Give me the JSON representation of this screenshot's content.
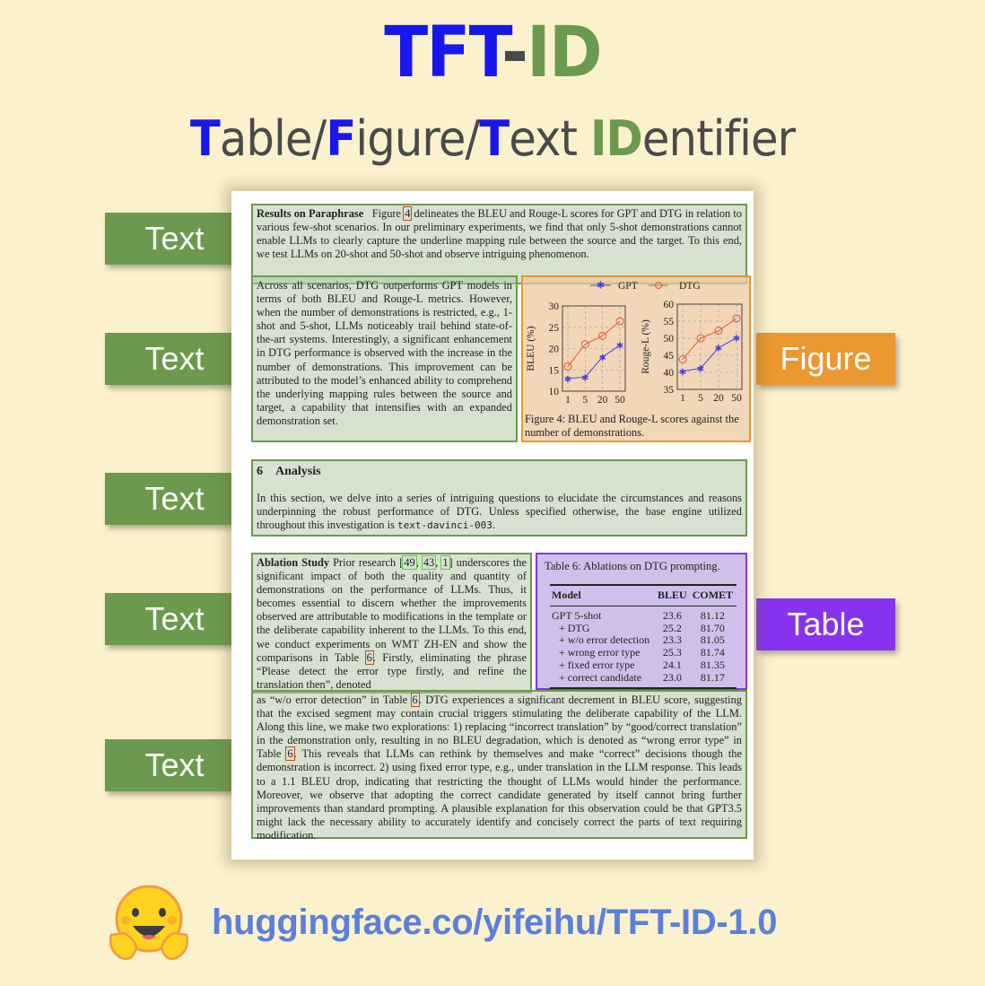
{
  "header": {
    "title_part1": "TFT",
    "title_dash": "-",
    "title_part2": "ID",
    "subtitle": [
      {
        "hl": "T",
        "rest": "able/",
        "color": "blue"
      },
      {
        "hl": "F",
        "rest": "igure/",
        "color": "blue"
      },
      {
        "hl": "T",
        "rest": "ext ",
        "color": "blue"
      },
      {
        "hl": "ID",
        "rest": "entifier",
        "color": "green"
      }
    ]
  },
  "colors": {
    "background": "#fbf1cd",
    "blue": "#1818ee",
    "green": "#6b9a4e",
    "text_label": "#6b9a4e",
    "figure_label": "#eb9830",
    "table_label": "#8533f0",
    "link": "#5a7fdc"
  },
  "labels": {
    "text": "Text",
    "figure": "Figure",
    "table": "Table"
  },
  "document": {
    "block1": {
      "heading": "Results on Paraphrase",
      "pre_ref": "Figure ",
      "ref": "4",
      "body": " delineates the BLEU and Rouge-L scores for GPT and DTG in relation to various few-shot scenarios.  In our preliminary experiments, we find that only 5-shot demonstrations cannot enable LLMs to clearly capture the underline mapping rule between the source and the target.  To this end, we test LLMs on 20-shot and 50-shot and observe intriguing phenomenon."
    },
    "block2": {
      "body": "Across all scenarios, DTG outperforms GPT models in terms of both BLEU and Rouge-L metrics. However, when the number of demonstrations is restricted, e.g., 1-shot and 5-shot, LLMs noticeably trail behind state-of-the-art systems.  Interestingly, a significant enhancement in DTG performance is observed with the increase in the number of demonstrations. This improvement can be attributed to the model’s enhanced ability to comprehend the underlying mapping rules between the source and target, a capability that intensifies with an expanded demonstration set."
    },
    "figure": {
      "legend": [
        "GPT",
        "DTG"
      ],
      "caption": "Figure 4: BLEU and Rouge-L scores against the number of demonstrations."
    },
    "block3": {
      "section_number": "6",
      "section_title": "Analysis",
      "body": "In this section, we delve into a series of intriguing questions to elucidate the circumstances and reasons underpinning the robust performance of DTG. Unless specified otherwise, the base engine utilized throughout this investigation is ",
      "code": "text-davinci-003",
      "end": "."
    },
    "block4": {
      "heading": "Ablation Study",
      "pre": "  Prior research [",
      "refs": [
        "49",
        "43",
        "1"
      ],
      "body": "] underscores the significant impact of both the quality and quantity of demonstrations on the performance of LLMs.  Thus, it becomes essential to discern whether the improvements observed are attributable to modifications in the template or the deliberate capability inherent to the LLMs. To this end, we conduct experiments on WMT ZH-EN and show the comparisons in Table ",
      "ref": "6",
      "tail": ". Firstly, eliminating the phrase “Please detect the error type firstly, and refine the translation then”, denoted"
    },
    "table": {
      "caption": "Table 6:  Ablations on DTG prompting.",
      "columns": [
        "Model",
        "BLEU",
        "COMET"
      ],
      "rows": [
        [
          "GPT 5-shot",
          "23.6",
          "81.12"
        ],
        [
          "+ DTG",
          "25.2",
          "81.70"
        ],
        [
          "+ w/o error detection",
          "23.3",
          "81.05"
        ],
        [
          "+ wrong error type",
          "25.3",
          "81.74"
        ],
        [
          "+ fixed error type",
          "24.1",
          "81.35"
        ],
        [
          "+ correct candidate",
          "23.0",
          "81.17"
        ]
      ]
    },
    "block5": {
      "p1": "as “w/o error detection” in Table ",
      "ref1": "6",
      "p2": ". DTG experiences a significant decrement in BLEU score, suggesting that the excised segment may contain crucial triggers stimulating the deliberate capability of the LLM. Along this line, we make two explorations: 1) replacing “incorrect translation” by “good/correct translation” in the demonstration only, resulting in no BLEU degradation, which is denoted as “wrong error type” in Table ",
      "ref2": "6",
      "p3": ".  This reveals that LLMs can rethink by themselves and make “correct” decisions though the demonstration is incorrect.  2) using fixed error type, e.g., under translation in the LLM response.  This leads to a 1.1 BLEU drop, indicating that restricting the thought of LLMs would hinder the performance. Moreover, we observe that adopting the correct candidate generated by itself cannot bring further improvements than standard prompting.  A plausible explanation for this observation could be that GPT3.5 might lack the necessary ability to accurately identify and concisely correct the parts of text requiring modification."
    }
  },
  "chart_data": [
    {
      "type": "line",
      "title": "",
      "xlabel": "",
      "ylabel": "BLEU (%)",
      "categories": [
        "1",
        "5",
        "20",
        "50"
      ],
      "ylim": [
        10,
        30
      ],
      "yticks": [
        "10",
        "15",
        "20",
        "25",
        "30"
      ],
      "grid": true,
      "legend": "top",
      "series": [
        {
          "name": "GPT",
          "marker": "star",
          "color": "#4b3fd8",
          "values": [
            13.0,
            13.3,
            18.0,
            20.8
          ]
        },
        {
          "name": "DTG",
          "marker": "circle",
          "color": "#e0583a",
          "values": [
            15.8,
            21.0,
            23.0,
            26.4
          ]
        }
      ]
    },
    {
      "type": "line",
      "title": "",
      "xlabel": "",
      "ylabel": "Rouge-L (%)",
      "categories": [
        "1",
        "5",
        "20",
        "50"
      ],
      "ylim": [
        35,
        60
      ],
      "yticks": [
        "35",
        "40",
        "45",
        "50",
        "55",
        "60"
      ],
      "grid": true,
      "legend": "top",
      "series": [
        {
          "name": "GPT",
          "marker": "star",
          "color": "#4b3fd8",
          "values": [
            40.3,
            41.2,
            47.2,
            50.1
          ]
        },
        {
          "name": "DTG",
          "marker": "circle",
          "color": "#e0583a",
          "values": [
            43.8,
            50.0,
            52.2,
            55.8
          ]
        }
      ]
    }
  ],
  "footer": {
    "logo": "hugging-face-emoji",
    "link": "huggingface.co/yifeihu/TFT-ID-1.0"
  }
}
